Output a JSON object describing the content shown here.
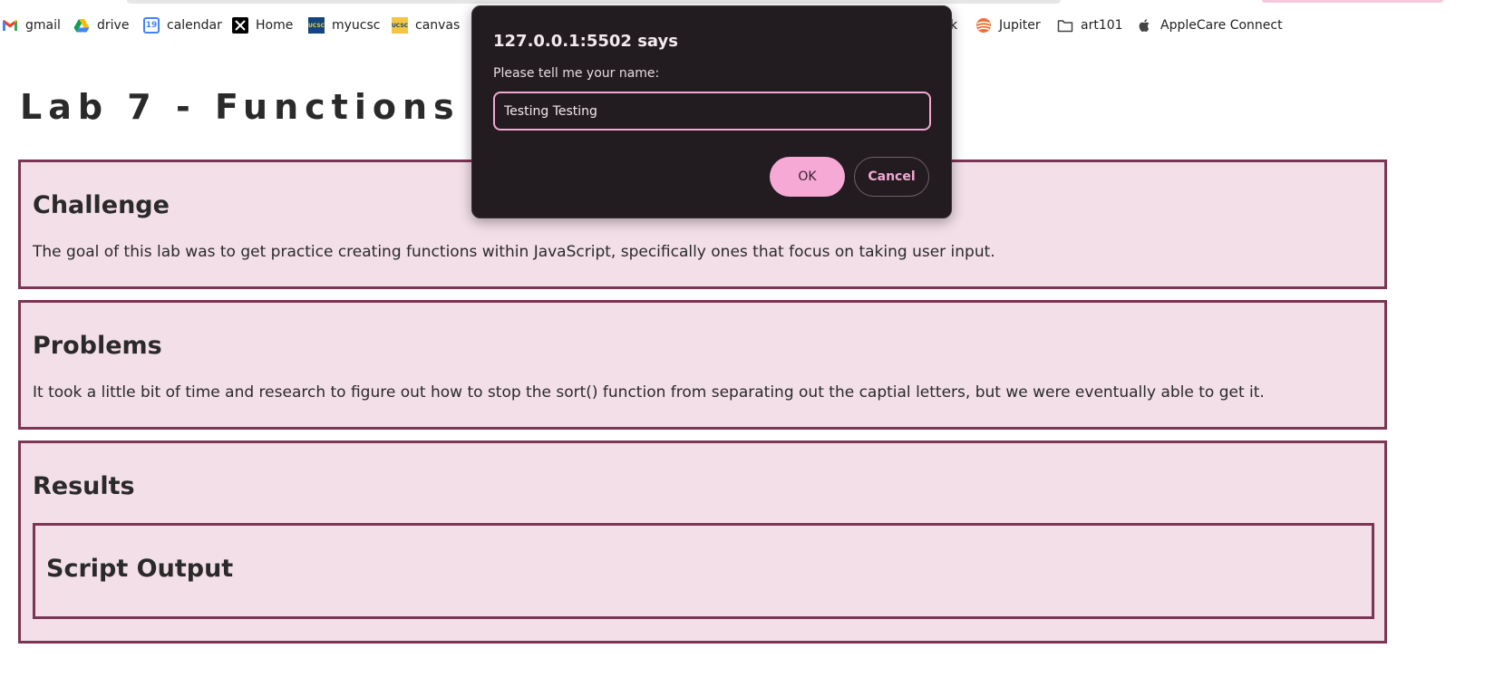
{
  "bookmarks": [
    {
      "label": "gmail",
      "icon": "gmail-icon"
    },
    {
      "label": "drive",
      "icon": "drive-icon"
    },
    {
      "label": "calendar",
      "icon": "calendar-icon",
      "icon_text": "19"
    },
    {
      "label": "Home",
      "icon": "x-icon"
    },
    {
      "label": "myucsc",
      "icon": "ucsc-icon",
      "icon_text": "UCSC"
    },
    {
      "label": "canvas",
      "icon": "ucsc-canvas-icon",
      "icon_text": "UCSC"
    },
    {
      "label": "k"
    },
    {
      "label": "Jupiter",
      "icon": "jupiter-icon"
    },
    {
      "label": "art101",
      "icon": "folder-icon"
    },
    {
      "label": "AppleCare Connect",
      "icon": "apple-icon"
    }
  ],
  "page": {
    "title": "Lab 7 - Functions",
    "sections": [
      {
        "heading": "Challenge",
        "text": "The goal of this lab was to get practice creating functions within JavaScript, specifically ones that focus on taking user input."
      },
      {
        "heading": "Problems",
        "text": "It took a little bit of time and research to figure out how to stop the sort() function from separating out the captial letters, but we were eventually able to get it."
      },
      {
        "heading": "Results",
        "inner_heading": "Script Output"
      }
    ]
  },
  "dialog": {
    "title": "127.0.0.1:5502 says",
    "message": "Please tell me your name:",
    "input_value": "Testing Testing",
    "ok_label": "OK",
    "cancel_label": "Cancel"
  },
  "colors": {
    "panel_bg": "#f3dfe8",
    "panel_border": "#7b3555",
    "dialog_bg": "#221b1f",
    "accent_pink": "#f7a9d6"
  }
}
